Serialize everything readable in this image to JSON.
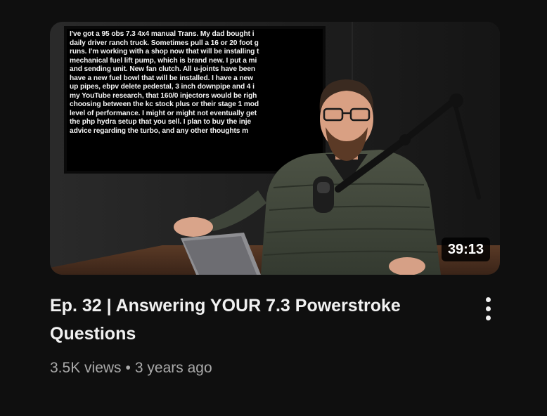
{
  "video": {
    "duration": "39:13",
    "title": "Ep. 32 | Answering YOUR 7.3 Powerstroke Questions",
    "views": "3.5K views",
    "separator": "•",
    "age": "3 years ago",
    "screen_lines": [
      "I've got a 95 obs 7.3 4x4 manual Trans. My dad bought i",
      "daily driver ranch truck. Sometimes pull a 16 or 20 foot g",
      "runs. I'm working with a shop now that will be installing t",
      "mechanical fuel lift pump, which is brand new. I put a mi",
      "and sending unit. New fan clutch. All u-joints have been",
      "have a new fuel bowl that will be installed. I have a new",
      "up pipes, ebpv delete pedestal, 3 inch downpipe and 4 i",
      "my YouTube research, that 160/0 injectors would be righ",
      "choosing between the kc stock plus or their stage 1 mod",
      "level of performance. I might or might not eventually get",
      "the php hydra setup that you sell. I plan to buy the inje",
      "advice regarding the turbo, and any other thoughts m"
    ]
  }
}
